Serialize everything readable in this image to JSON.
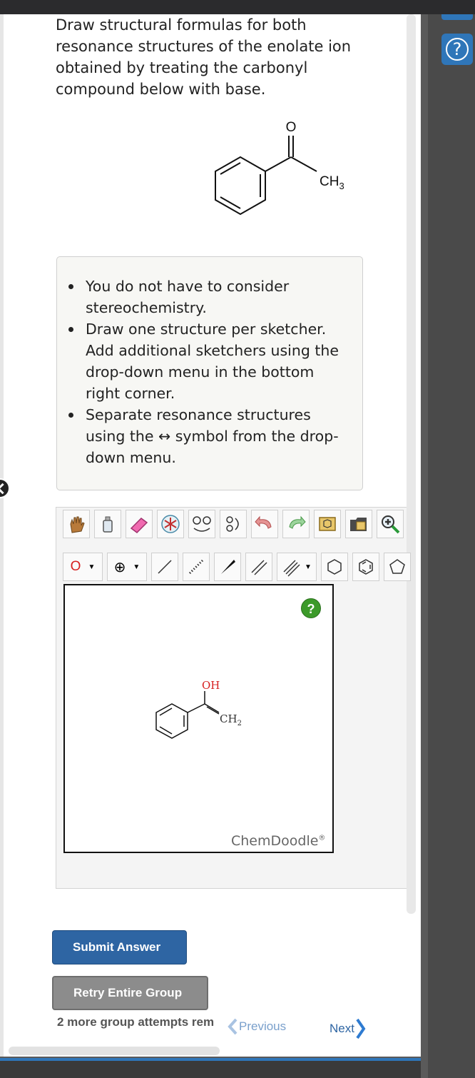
{
  "question": {
    "text": "Draw structural formulas for both resonance structures of the enolate ion obtained by treating the carbonyl compound below with base."
  },
  "molecule_top": {
    "oxygen_label": "O",
    "methyl_label": "CH",
    "methyl_sub": "3"
  },
  "notes": {
    "items": [
      "You do not have to consider stereochemistry.",
      "Draw one structure per sketcher. Add additional sketchers using the drop-down menu in the bottom right corner.",
      "Separate resonance structures using the ↔ symbol from the drop-down menu."
    ]
  },
  "sketcher": {
    "atom_tool_label": "O",
    "charge_tool_label": "⊕",
    "help_label": "?",
    "brand": "ChemDoodle",
    "brand_mark": "®",
    "drawn_molecule": {
      "oh_label": "OH",
      "ch2_label": "CH",
      "ch2_sub": "2"
    }
  },
  "buttons": {
    "submit_label": "Submit Answer",
    "retry_label": "Retry Entire Group"
  },
  "footer": {
    "attempts_text": "2 more group attempts rem",
    "previous_label": "Previous",
    "next_label": "Next"
  },
  "colors": {
    "accent": "#2e65a3",
    "oxygen_red": "#d62020",
    "help_green": "#3c9a2a"
  }
}
